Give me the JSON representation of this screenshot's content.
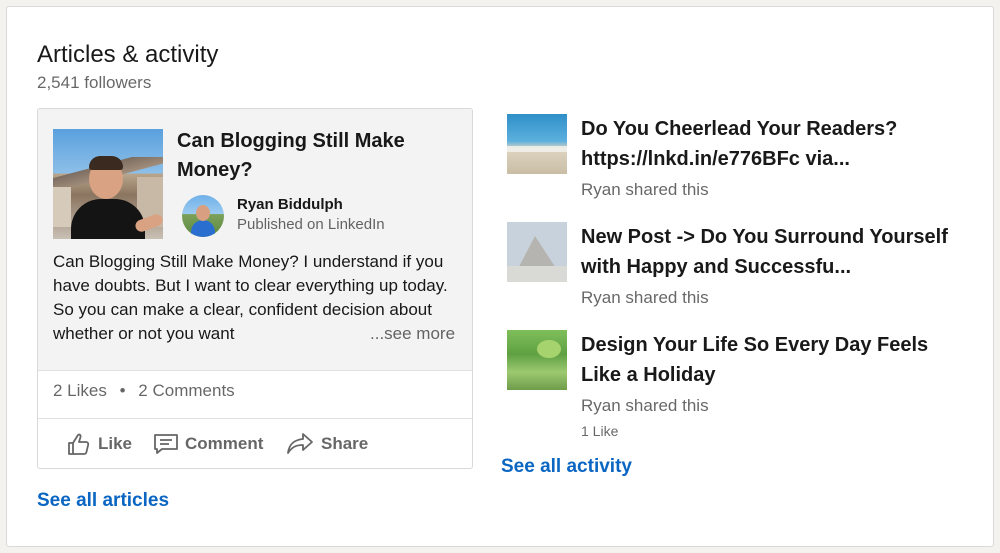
{
  "section": {
    "title": "Articles & activity",
    "followers": "2,541 followers"
  },
  "article": {
    "title": "Can Blogging Still Make Money?",
    "author": "Ryan Biddulph",
    "meta": "Published on LinkedIn",
    "excerpt": "Can Blogging Still Make Money? I understand if you have doubts. But I want to clear everything up today. So you can make a clear, confident decision about whether or not you want",
    "see_more": "...see more",
    "likes": "2 Likes",
    "separator": "•",
    "comments": "2 Comments",
    "actions": {
      "like": "Like",
      "comment": "Comment",
      "share": "Share"
    },
    "icons": {
      "like": "thumbs-up-icon",
      "comment": "comment-icon",
      "share": "share-arrow-icon"
    }
  },
  "links": {
    "see_all_articles": "See all articles",
    "see_all_activity": "See all activity"
  },
  "activity": [
    {
      "title": "Do You Cheerlead Your Readers? https://lnkd.in/e776BFc via...",
      "subtitle": "Ryan shared this"
    },
    {
      "title": "New Post -> Do You Surround Yourself with Happy and Successfu...",
      "subtitle": "Ryan shared this"
    },
    {
      "title": "Design Your Life So Every Day Feels Like a Holiday",
      "subtitle": "Ryan shared this",
      "likes": "1 Like"
    }
  ],
  "colors": {
    "link": "#0a66c2",
    "article_background": "#f3f3f3",
    "page_background": "#f3f2ef"
  }
}
